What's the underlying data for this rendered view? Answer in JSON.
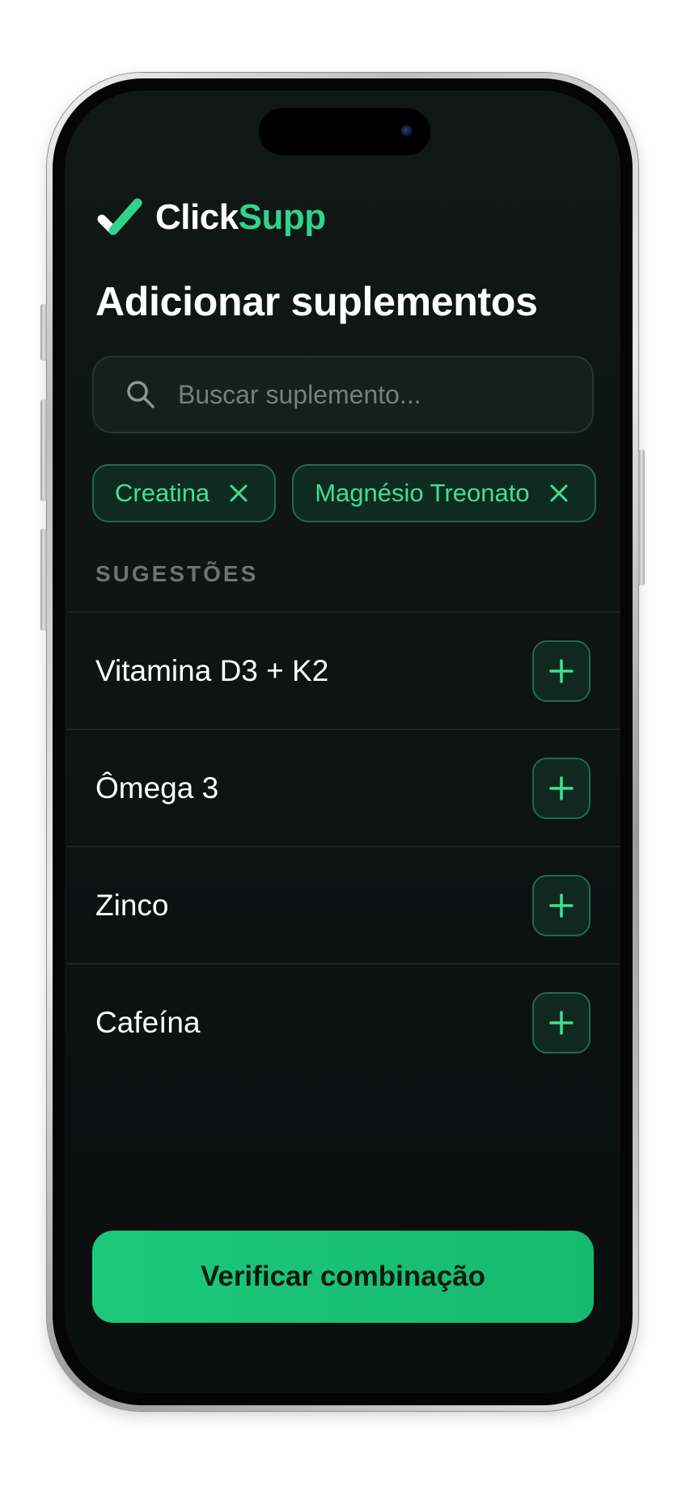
{
  "brand": {
    "name_part1": "Click",
    "name_part2": "Supp",
    "logo_icon": "check-icon",
    "accent_color": "#2fd48a"
  },
  "page": {
    "title": "Adicionar suplementos"
  },
  "search": {
    "placeholder": "Buscar suplemento...",
    "value": "",
    "icon": "search-icon"
  },
  "selected": [
    {
      "label": "Creatina",
      "remove_icon": "close-icon"
    },
    {
      "label": "Magnésio Treonato",
      "remove_icon": "close-icon"
    }
  ],
  "suggestions": {
    "heading": "SUGESTÕES",
    "items": [
      {
        "label": "Vitamina D3 + K2",
        "action_icon": "plus-icon"
      },
      {
        "label": "Ômega 3",
        "action_icon": "plus-icon"
      },
      {
        "label": "Zinco",
        "action_icon": "plus-icon"
      },
      {
        "label": "Cafeína",
        "action_icon": "plus-icon"
      }
    ]
  },
  "actions": {
    "verify_label": "Verificar combinação"
  },
  "colors": {
    "background": "#0d1412",
    "accent": "#2fd48a",
    "cta": "#1cc97a",
    "muted": "#6b7671"
  }
}
